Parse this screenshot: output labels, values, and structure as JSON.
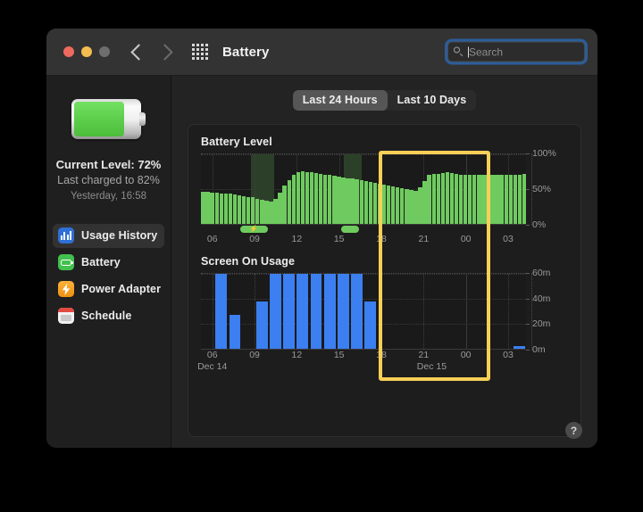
{
  "window": {
    "title": "Battery",
    "traffic_lights": [
      "close",
      "minimize",
      "zoom"
    ],
    "nav": {
      "back": "back-chevron",
      "forward": "forward-chevron",
      "grid": "all-preferences-grid"
    }
  },
  "search": {
    "placeholder": "Search",
    "value": "",
    "icon": "search-icon",
    "focused": true
  },
  "sidebar": {
    "battery_icon": "battery-large-icon",
    "battery_fill_percent": 72,
    "current_level": "Current Level: 72%",
    "last_charged": "Last charged to 82%",
    "charged_time": "Yesterday, 16:58",
    "items": [
      {
        "label": "Usage History",
        "icon": "usage-history-icon",
        "selected": true
      },
      {
        "label": "Battery",
        "icon": "battery-icon",
        "selected": false
      },
      {
        "label": "Power Adapter",
        "icon": "power-adapter-icon",
        "selected": false
      },
      {
        "label": "Schedule",
        "icon": "schedule-icon",
        "selected": false
      }
    ]
  },
  "tabs": [
    {
      "label": "Last 24 Hours",
      "active": true
    },
    {
      "label": "Last 10 Days",
      "active": false
    }
  ],
  "help_button": {
    "label": "?",
    "name": "help-button"
  },
  "highlight": {
    "color": "#f8cf57",
    "left_pct": 54.5,
    "right_pct": 86.5
  },
  "chart_data": [
    {
      "type": "bar",
      "name": "battery-level-chart",
      "title": "Battery Level",
      "xlabel": "",
      "ylabel": "",
      "ylim": [
        0,
        100
      ],
      "yticks": [
        0,
        50,
        100
      ],
      "ytick_labels": [
        "0%",
        "50%",
        "100%"
      ],
      "xticks": [
        6,
        9,
        12,
        15,
        18,
        21,
        0,
        3
      ],
      "xtick_labels": [
        "06",
        "09",
        "12",
        "15",
        "18",
        "21",
        "00",
        "03"
      ],
      "bar_color": "#6fcb5f",
      "grid": true,
      "categories": [
        "05:00",
        "05:20",
        "05:40",
        "06:00",
        "06:20",
        "06:40",
        "07:00",
        "07:20",
        "07:40",
        "08:00",
        "08:20",
        "08:40",
        "09:00",
        "09:20",
        "09:40",
        "10:00",
        "10:20",
        "10:40",
        "11:00",
        "11:20",
        "11:40",
        "12:00",
        "12:20",
        "12:40",
        "13:00",
        "13:20",
        "13:40",
        "14:00",
        "14:20",
        "14:40",
        "15:00",
        "15:20",
        "15:40",
        "16:00",
        "16:20",
        "16:40",
        "17:00",
        "17:20",
        "17:40",
        "18:00",
        "18:20",
        "18:40",
        "19:00",
        "19:20",
        "19:40",
        "20:00",
        "20:20",
        "20:40",
        "21:00",
        "21:20",
        "21:40",
        "22:00",
        "22:20",
        "22:40",
        "23:00",
        "23:20",
        "23:40",
        "00:00",
        "00:20",
        "00:40",
        "01:00",
        "01:20",
        "01:40",
        "02:00",
        "02:20",
        "02:40",
        "03:00",
        "03:20",
        "03:40",
        "04:00",
        "04:20",
        "04:40"
      ],
      "values": [
        46,
        46,
        45,
        45,
        44,
        44,
        43,
        42,
        41,
        40,
        39,
        38,
        36,
        34,
        33,
        32,
        36,
        45,
        55,
        63,
        70,
        74,
        76,
        75,
        74,
        73,
        72,
        71,
        70,
        69,
        68,
        67,
        66,
        65,
        64,
        63,
        62,
        60,
        59,
        58,
        56,
        55,
        54,
        52,
        51,
        50,
        49,
        48,
        52,
        62,
        70,
        72,
        72,
        73,
        74,
        73,
        72,
        71,
        71,
        71,
        71,
        71,
        71,
        71,
        71,
        71,
        71,
        71,
        71,
        71,
        71,
        72
      ],
      "charging_bands": [
        {
          "start_pct": 15.5,
          "width_pct": 7.0,
          "has_bolt": true
        },
        {
          "start_pct": 44.0,
          "width_pct": 5.5,
          "has_bolt": false
        }
      ],
      "charge_pills": [
        {
          "left_pct": 12.0,
          "width_pct": 8.5,
          "bolt": "⚡"
        },
        {
          "left_pct": 43.0,
          "width_pct": 5.5,
          "bolt": ""
        }
      ]
    },
    {
      "type": "bar",
      "name": "screen-on-usage-chart",
      "title": "Screen On Usage",
      "xlabel": "",
      "ylabel": "",
      "ylim": [
        0,
        60
      ],
      "yticks": [
        0,
        20,
        40,
        60
      ],
      "ytick_labels": [
        "0m",
        "20m",
        "40m",
        "60m"
      ],
      "xticks": [
        6,
        9,
        12,
        15,
        18,
        21,
        0,
        3
      ],
      "xtick_labels": [
        "06",
        "09",
        "12",
        "15",
        "18",
        "21",
        "00",
        "03"
      ],
      "day_labels": [
        {
          "text": "Dec 14",
          "at_pct": 3.5
        },
        {
          "text": "Dec 15",
          "at_pct": 71.0
        }
      ],
      "bar_color": "#3b7ff0",
      "grid": true,
      "categories": [
        "05",
        "06",
        "07",
        "08",
        "09",
        "10",
        "11",
        "12",
        "13",
        "14",
        "15",
        "16",
        "17",
        "18",
        "19",
        "20",
        "21",
        "22",
        "23",
        "00",
        "01",
        "02",
        "03",
        "04"
      ],
      "values": [
        0,
        60,
        27,
        0,
        38,
        60,
        60,
        60,
        60,
        60,
        60,
        60,
        38,
        0,
        0,
        0,
        0,
        0,
        0,
        0,
        0,
        0,
        0,
        2
      ]
    }
  ]
}
